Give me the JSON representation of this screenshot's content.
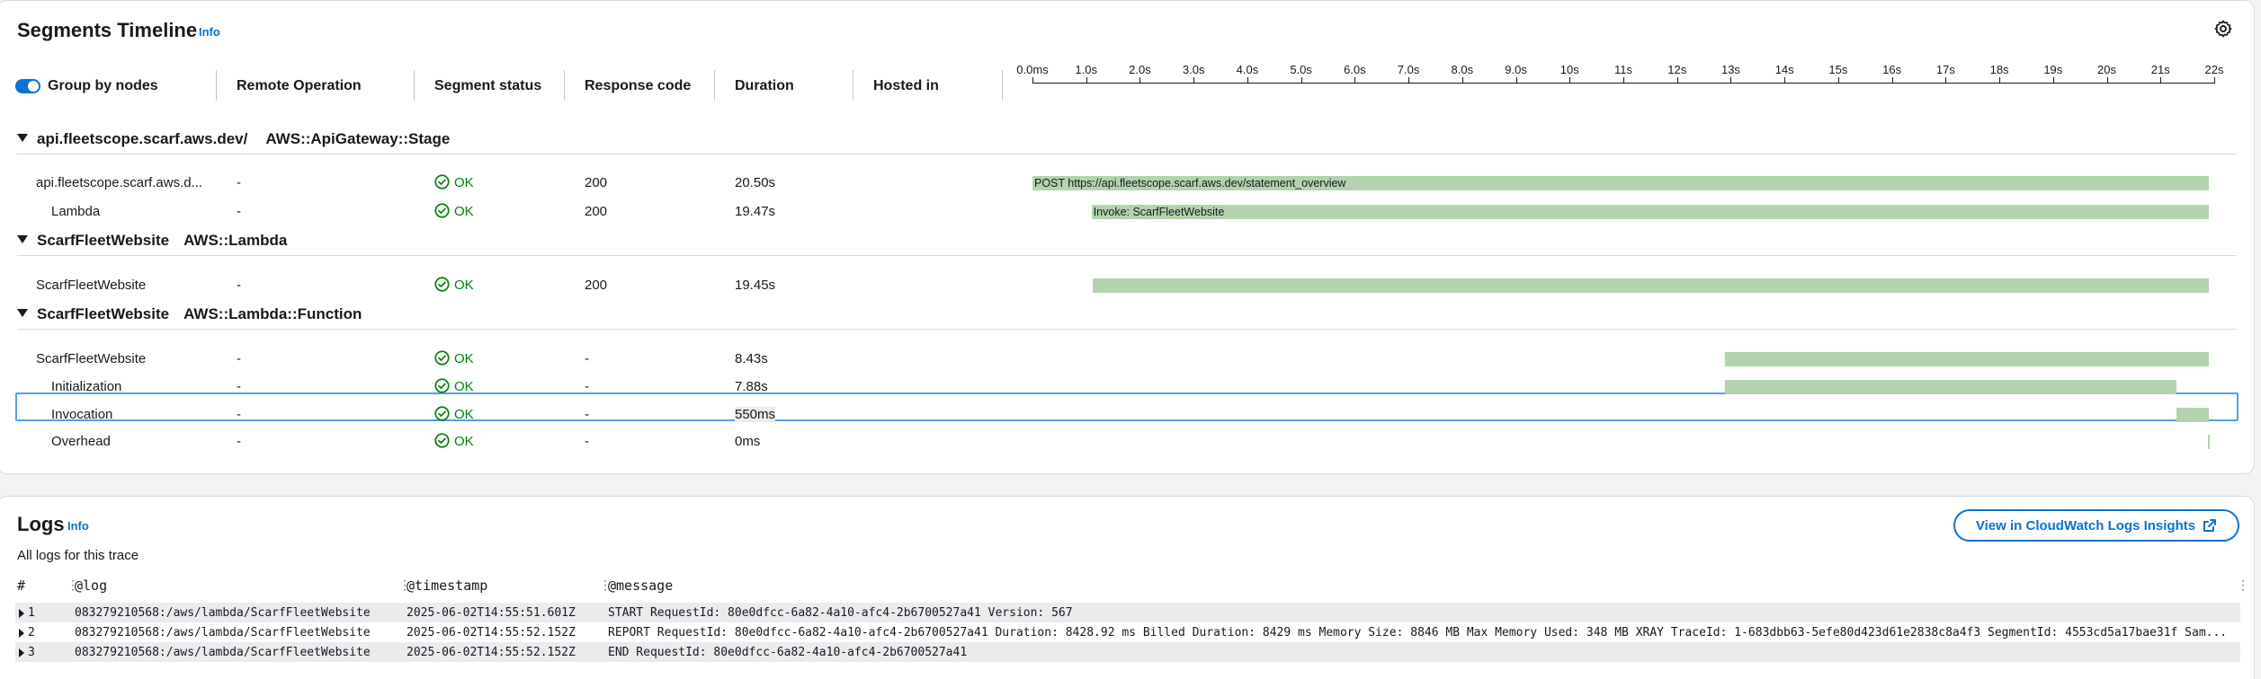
{
  "timeline": {
    "title": "Segments Timeline",
    "info": "Info",
    "group_toggle_label": "Group by nodes",
    "columns": {
      "remote_operation": "Remote Operation",
      "segment_status": "Segment status",
      "response_code": "Response code",
      "duration": "Duration",
      "hosted_in": "Hosted in"
    },
    "ticks": [
      "0.0ms",
      "1.0s",
      "2.0s",
      "3.0s",
      "4.0s",
      "5.0s",
      "6.0s",
      "7.0s",
      "8.0s",
      "9.0s",
      "10s",
      "11s",
      "12s",
      "13s",
      "14s",
      "15s",
      "16s",
      "17s",
      "18s",
      "19s",
      "20s",
      "21s",
      "22s"
    ],
    "groups": [
      {
        "name": "api.fleetscope.scarf.aws.dev/",
        "type": "AWS::ApiGateway::Stage",
        "rows": [
          {
            "name": "api.fleetscope.scarf.aws.d...",
            "remote": "-",
            "status": "OK",
            "code": "200",
            "duration": "20.50s",
            "bar_label": "POST https://api.fleetscope.scarf.aws.dev/statement_overview",
            "start_s": 0.0,
            "end_s": 21.9
          },
          {
            "name": "Lambda",
            "remote": "-",
            "status": "OK",
            "code": "200",
            "duration": "19.47s",
            "bar_label": "Invoke: ScarfFleetWebsite",
            "start_s": 1.1,
            "end_s": 21.9
          }
        ]
      },
      {
        "name": "ScarfFleetWebsite",
        "type": "AWS::Lambda",
        "rows": [
          {
            "name": "ScarfFleetWebsite",
            "remote": "-",
            "status": "OK",
            "code": "200",
            "duration": "19.45s",
            "bar_label": "",
            "start_s": 1.12,
            "end_s": 21.9
          }
        ]
      },
      {
        "name": "ScarfFleetWebsite",
        "type": "AWS::Lambda::Function",
        "rows": [
          {
            "name": "ScarfFleetWebsite",
            "remote": "-",
            "status": "OK",
            "code": "-",
            "duration": "8.43s",
            "bar_label": "",
            "start_s": 12.9,
            "end_s": 21.9
          },
          {
            "name": "Initialization",
            "remote": "-",
            "status": "OK",
            "code": "-",
            "duration": "7.88s",
            "bar_label": "",
            "start_s": 12.9,
            "end_s": 21.3
          },
          {
            "name": "Invocation",
            "remote": "-",
            "status": "OK",
            "code": "-",
            "duration": "550ms",
            "bar_label": "",
            "start_s": 21.3,
            "end_s": 21.9
          },
          {
            "name": "Overhead",
            "remote": "-",
            "status": "OK",
            "code": "-",
            "duration": "0ms",
            "bar_label": "",
            "start_s": 21.88,
            "end_s": 21.9
          }
        ]
      }
    ]
  },
  "logs": {
    "title": "Logs",
    "info": "Info",
    "subtitle": "All logs for this trace",
    "cloudwatch_button": "View in CloudWatch Logs Insights",
    "columns": {
      "index": "#",
      "log": "@log",
      "timestamp": "@timestamp",
      "message": "@message"
    },
    "rows": [
      {
        "index": "1",
        "log": "083279210568:/aws/lambda/ScarfFleetWebsite",
        "timestamp": "2025-06-02T14:55:51.601Z",
        "message": "START RequestId: 80e0dfcc-6a82-4a10-afc4-2b6700527a41 Version: 567"
      },
      {
        "index": "2",
        "log": "083279210568:/aws/lambda/ScarfFleetWebsite",
        "timestamp": "2025-06-02T14:55:52.152Z",
        "message": "REPORT RequestId: 80e0dfcc-6a82-4a10-afc4-2b6700527a41 Duration: 8428.92 ms Billed Duration: 8429 ms Memory Size: 8846 MB Max Memory Used: 348 MB XRAY TraceId: 1-683dbb63-5efe80d423d61e2838c8a4f3 SegmentId: 4553cd5a17bae31f Sam..."
      },
      {
        "index": "3",
        "log": "083279210568:/aws/lambda/ScarfFleetWebsite",
        "timestamp": "2025-06-02T14:55:52.152Z",
        "message": "END RequestId: 80e0dfcc-6a82-4a10-afc4-2b6700527a41"
      }
    ]
  },
  "colors": {
    "accent": "#0972d3",
    "ok": "#037f0c",
    "bar": "#b2d3ad",
    "selected_border": "#539fe5"
  },
  "icons": [
    "settings-gear-icon",
    "toggle-icon",
    "caret-down-icon",
    "status-ok-icon",
    "external-link-icon",
    "expand-row-icon",
    "column-resize-icon"
  ]
}
